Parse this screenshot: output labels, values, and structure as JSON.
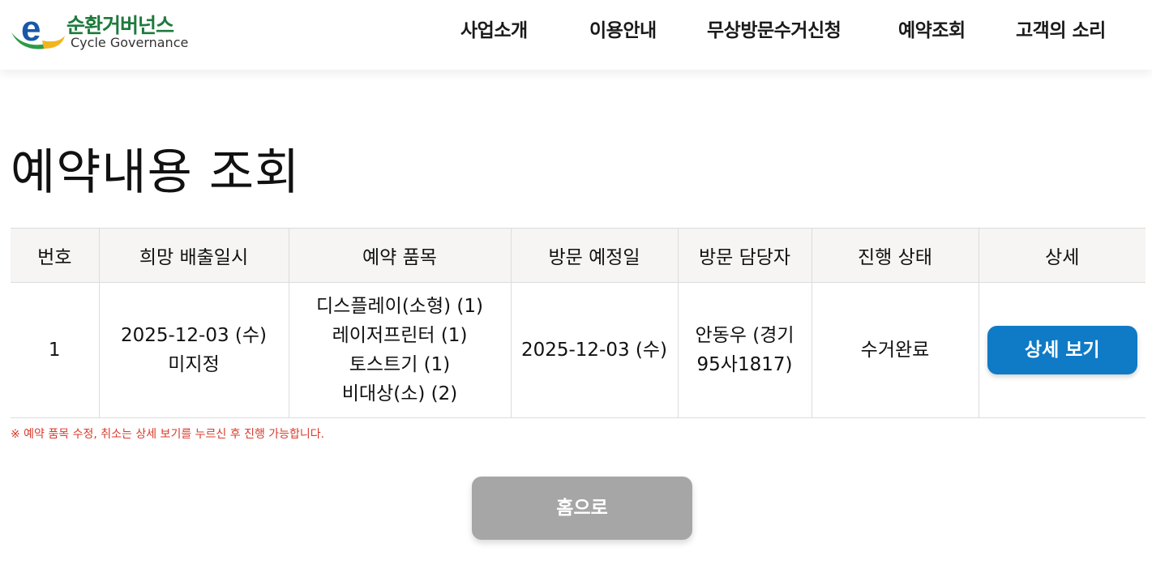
{
  "header": {
    "logo": {
      "name_ko": "순환거버넌스",
      "name_en": "Cycle Governance",
      "icon": "e-logo-icon"
    },
    "nav": [
      "사업소개",
      "이용안내",
      "무상방문수거신청",
      "예약조회",
      "고객의 소리"
    ]
  },
  "page": {
    "title": "예약내용 조회"
  },
  "table": {
    "columns": [
      "번호",
      "희망 배출일시",
      "예약 품목",
      "방문 예정일",
      "방문 담당자",
      "진행 상태",
      "상세"
    ],
    "rows": [
      {
        "no": "1",
        "desired_datetime": [
          "2025-12-03 (수)",
          "미지정"
        ],
        "items": [
          "디스플레이(소형) (1)",
          "레이저프린터 (1)",
          "토스트기 (1)",
          "비대상(소) (2)"
        ],
        "visit_date": "2025-12-03 (수)",
        "staff": [
          "안동우 (경기",
          "95사1817)"
        ],
        "status": "수거완료",
        "detail_label": "상세 보기"
      }
    ]
  },
  "notice": "※ 예약 품목 수정, 취소는 상세 보기를 누르신 후 진행 가능합니다.",
  "home_button": "홈으로",
  "colors": {
    "brand_green": "#1d7a3c",
    "primary_blue": "#0f7ac6",
    "status_blue": "#1f5fb4",
    "notice_red": "#d93a2b",
    "home_gray": "#a6a6a6"
  }
}
